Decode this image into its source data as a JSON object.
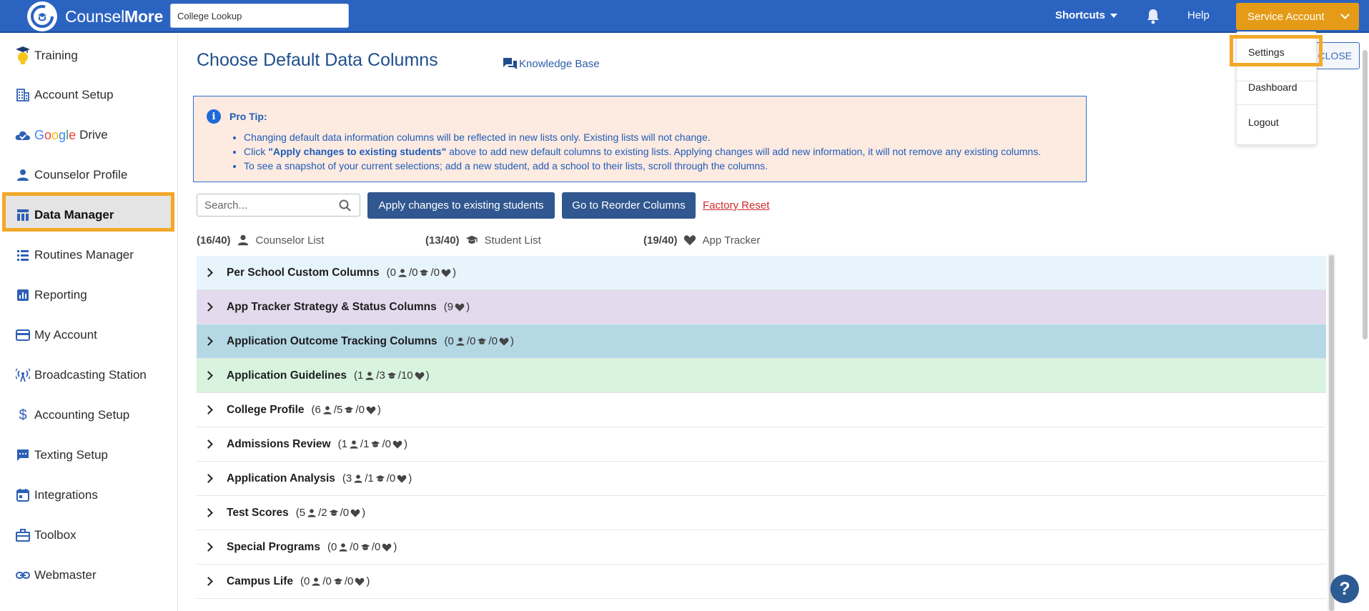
{
  "header": {
    "logo_text_light": "Counsel",
    "logo_text_bold": "More",
    "college_lookup_placeholder": "College Lookup",
    "shortcuts_label": "Shortcuts",
    "help_label": "Help",
    "account_label": "Service Account"
  },
  "account_menu": {
    "items": [
      "Settings",
      "Dashboard",
      "Logout"
    ]
  },
  "sidebar": {
    "items": [
      {
        "label": "Training",
        "icon": "training-bulb-icon"
      },
      {
        "label": "Account Setup",
        "icon": "building-icon"
      },
      {
        "label": "Drive",
        "icon": "google-drive-icon",
        "prefix": "Google"
      },
      {
        "label": "Counselor Profile",
        "icon": "person-icon"
      },
      {
        "label": "Data Manager",
        "icon": "table-icon",
        "active": true
      },
      {
        "label": "Routines Manager",
        "icon": "list-icon"
      },
      {
        "label": "Reporting",
        "icon": "bar-chart-icon"
      },
      {
        "label": "My Account",
        "icon": "credit-card-icon"
      },
      {
        "label": "Broadcasting Station",
        "icon": "broadcast-icon"
      },
      {
        "label": "Accounting Setup",
        "icon": "dollar-icon"
      },
      {
        "label": "Texting Setup",
        "icon": "chat-icon"
      },
      {
        "label": "Integrations",
        "icon": "calendar-icon"
      },
      {
        "label": "Toolbox",
        "icon": "toolbox-icon"
      },
      {
        "label": "Webmaster",
        "icon": "link-icon"
      }
    ]
  },
  "main": {
    "title": "Choose Default Data Columns",
    "knowledge_base": "Knowledge Base",
    "close_label": "CLOSE",
    "protip": {
      "heading": "Pro Tip:",
      "bullet1": "Changing default data information columns will be reflected in new lists only. Existing lists will not change.",
      "bullet2_pre": "Click ",
      "bullet2_bold": "\"Apply changes to existing students\"",
      "bullet2_post": " above to add new default columns to existing lists. Applying changes will add new information, it will not remove any existing columns.",
      "bullet3": "To see a snapshot of your current selections; add a new student, add a school to their lists, scroll through the columns."
    },
    "search_placeholder": "Search...",
    "apply_button": "Apply changes to existing students",
    "reorder_button": "Go to Reorder Columns",
    "factory_reset": "Factory Reset",
    "counts": {
      "counselor": {
        "value": "(16/40)",
        "label": "Counselor List"
      },
      "student": {
        "value": "(13/40)",
        "label": "Student List"
      },
      "tracker": {
        "value": "(19/40)",
        "label": "App Tracker"
      }
    },
    "groups": [
      {
        "name": "Per School Custom Columns",
        "counselor": "0",
        "student": "0",
        "tracker": "0",
        "color": "#e7f4fc"
      },
      {
        "name": "App Tracker Strategy & Status Columns",
        "tracker_only": "9",
        "color": "#e4daee"
      },
      {
        "name": "Application Outcome Tracking Columns",
        "counselor": "0",
        "student": "0",
        "tracker": "0",
        "color": "#b5d8e5"
      },
      {
        "name": "Application Guidelines",
        "counselor": "1",
        "student": "3",
        "tracker": "10",
        "color": "#d8f4df"
      },
      {
        "name": "College Profile",
        "counselor": "6",
        "student": "5",
        "tracker": "0",
        "color": "#ffffff"
      },
      {
        "name": "Admissions Review",
        "counselor": "1",
        "student": "1",
        "tracker": "0",
        "color": "#ffffff"
      },
      {
        "name": "Application Analysis",
        "counselor": "3",
        "student": "1",
        "tracker": "0",
        "color": "#ffffff"
      },
      {
        "name": "Test Scores",
        "counselor": "5",
        "student": "2",
        "tracker": "0",
        "color": "#ffffff"
      },
      {
        "name": "Special Programs",
        "counselor": "0",
        "student": "0",
        "tracker": "0",
        "color": "#ffffff"
      },
      {
        "name": "Campus Life",
        "counselor": "0",
        "student": "0",
        "tracker": "0",
        "color": "#ffffff"
      }
    ]
  },
  "help_bubble": "?",
  "colors": {
    "brand_blue": "#2b63c1",
    "accent_orange": "#e59b17",
    "highlight": "#f3a829"
  }
}
